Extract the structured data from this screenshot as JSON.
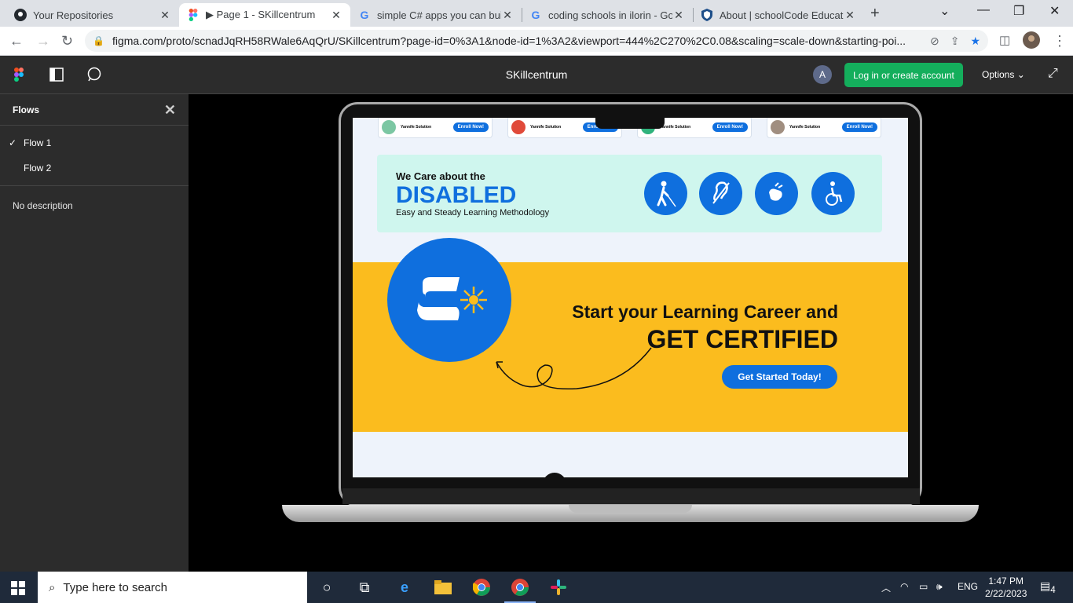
{
  "browser": {
    "tabs": [
      {
        "title": "Your Repositories",
        "icon": "github-icon"
      },
      {
        "title": "▶ Page 1 - SKillcentrum",
        "icon": "figma-icon",
        "active": true
      },
      {
        "title": "simple C# apps you can build",
        "icon": "google-icon"
      },
      {
        "title": "coding schools in ilorin - Goo",
        "icon": "google-icon"
      },
      {
        "title": "About | schoolCode Educatio",
        "icon": "shield-icon"
      }
    ],
    "url": "figma.com/proto/scnadJqRH58RWale6AqQrU/SKillcentrum?page-id=0%3A1&node-id=1%3A2&viewport=444%2C270%2C0.08&scaling=scale-down&starting-poi..."
  },
  "figma": {
    "title": "SKillcentrum",
    "avatar_letter": "A",
    "login_label": "Log in or create account",
    "options_label": "Options ⌄"
  },
  "sidebar": {
    "heading": "Flows",
    "flows": [
      "Flow 1",
      "Flow 2"
    ],
    "description": "No description"
  },
  "prototype": {
    "cards": [
      {
        "name": "Yannife Solution",
        "button": "Enroll Now!"
      },
      {
        "name": "Yannife Solution",
        "button": "Enroll Now!"
      },
      {
        "name": "Yannife Solution",
        "button": "Enroll Now!"
      },
      {
        "name": "Yannife Solution",
        "button": "Enroll Now!"
      }
    ],
    "care_line": "We Care about the",
    "disabled_word": "DISABLED",
    "easy_line": "Easy and Steady Learning Methodology",
    "disability_icons": [
      "blind-icon",
      "hearing-impaired-icon",
      "sign-language-icon",
      "wheelchair-icon"
    ],
    "cta_line1": "Start your Learning Career and",
    "cta_line2": "GET CERTIFIED",
    "cta_button": "Get Started Today!"
  },
  "taskbar": {
    "search_placeholder": "Type here to search",
    "language": "ENG",
    "time": "1:47 PM",
    "date": "2/22/2023",
    "notifications": "4"
  },
  "colors": {
    "brand_blue": "#0f6fde",
    "yellow": "#fbbc1e",
    "mint": "#cff6ee",
    "figma_green": "#14ae5c"
  }
}
